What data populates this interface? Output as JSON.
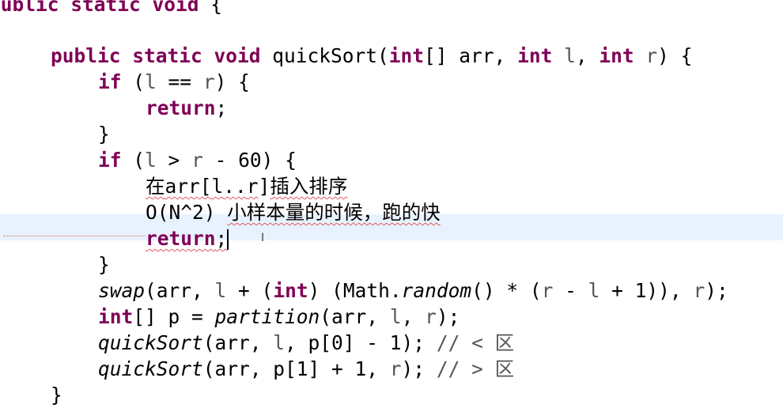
{
  "editor": {
    "current_line_index": 8,
    "colors": {
      "keyword": "#7f0055",
      "current_line": "#e8f2fe",
      "error_underline": "#e05a5a"
    },
    "lines": [
      {
        "indent": 0,
        "tokens": [
          {
            "t": "public static void ",
            "c": "kw"
          },
          {
            "t": "{",
            "c": ""
          }
        ]
      },
      {
        "indent": 0,
        "tokens": []
      },
      {
        "indent": 0,
        "tokens": [
          {
            "t": "public static void",
            "c": "kw"
          },
          {
            "t": " quickSort(",
            "c": ""
          },
          {
            "t": "int",
            "c": "kw"
          },
          {
            "t": "[] arr, ",
            "c": ""
          },
          {
            "t": "int",
            "c": "kw"
          },
          {
            "t": " ",
            "c": ""
          },
          {
            "t": "l",
            "c": "var"
          },
          {
            "t": ", ",
            "c": ""
          },
          {
            "t": "int",
            "c": "kw"
          },
          {
            "t": " ",
            "c": ""
          },
          {
            "t": "r",
            "c": "var"
          },
          {
            "t": ") {",
            "c": ""
          }
        ]
      },
      {
        "indent": 1,
        "tokens": [
          {
            "t": "if",
            "c": "kw"
          },
          {
            "t": " (",
            "c": ""
          },
          {
            "t": "l",
            "c": "var"
          },
          {
            "t": " == ",
            "c": ""
          },
          {
            "t": "r",
            "c": "var"
          },
          {
            "t": ") {",
            "c": ""
          }
        ]
      },
      {
        "indent": 2,
        "tokens": [
          {
            "t": "return",
            "c": "kw"
          },
          {
            "t": ";",
            "c": ""
          }
        ]
      },
      {
        "indent": 1,
        "tokens": [
          {
            "t": "}",
            "c": ""
          }
        ]
      },
      {
        "indent": 1,
        "tokens": [
          {
            "t": "if",
            "c": "kw"
          },
          {
            "t": " (",
            "c": ""
          },
          {
            "t": "l",
            "c": "var"
          },
          {
            "t": " > ",
            "c": ""
          },
          {
            "t": "r",
            "c": "var"
          },
          {
            "t": " - 60) {",
            "c": ""
          }
        ]
      },
      {
        "indent": 2,
        "tokens": [
          {
            "t": "在",
            "c": "cjk err"
          },
          {
            "t": "arr[",
            "c": "err"
          },
          {
            "t": "l",
            "c": "err"
          },
          {
            "t": "..",
            "c": "err"
          },
          {
            "t": "r",
            "c": "err"
          },
          {
            "t": "]",
            "c": ""
          },
          {
            "t": "插入排序",
            "c": "cjk err"
          }
        ]
      },
      {
        "indent": 2,
        "tokens": [
          {
            "t": "O(N^2) ",
            "c": ""
          },
          {
            "t": "小样本量的时候，跑的快",
            "c": "cjk err"
          }
        ]
      },
      {
        "indent": 2,
        "tokens": [
          {
            "t": "return",
            "c": "kw err"
          },
          {
            "t": ";",
            "c": "err"
          }
        ],
        "caret": true
      },
      {
        "indent": 1,
        "tokens": [
          {
            "t": "}",
            "c": ""
          }
        ]
      },
      {
        "indent": 1,
        "tokens": [
          {
            "t": "swap",
            "c": "it"
          },
          {
            "t": "(arr, ",
            "c": ""
          },
          {
            "t": "l",
            "c": "var"
          },
          {
            "t": " + (",
            "c": ""
          },
          {
            "t": "int",
            "c": "kw"
          },
          {
            "t": ") (Math.",
            "c": ""
          },
          {
            "t": "random",
            "c": "it"
          },
          {
            "t": "() * (",
            "c": ""
          },
          {
            "t": "r",
            "c": "var"
          },
          {
            "t": " - ",
            "c": ""
          },
          {
            "t": "l",
            "c": "var"
          },
          {
            "t": " + 1)), ",
            "c": ""
          },
          {
            "t": "r",
            "c": "var"
          },
          {
            "t": ");",
            "c": ""
          }
        ]
      },
      {
        "indent": 1,
        "tokens": [
          {
            "t": "int",
            "c": "kw"
          },
          {
            "t": "[] p = ",
            "c": ""
          },
          {
            "t": "partition",
            "c": "it"
          },
          {
            "t": "(arr, ",
            "c": ""
          },
          {
            "t": "l",
            "c": "var"
          },
          {
            "t": ", ",
            "c": ""
          },
          {
            "t": "r",
            "c": "var"
          },
          {
            "t": ");",
            "c": ""
          }
        ]
      },
      {
        "indent": 1,
        "tokens": [
          {
            "t": "quickSort",
            "c": "it"
          },
          {
            "t": "(arr, ",
            "c": ""
          },
          {
            "t": "l",
            "c": "var"
          },
          {
            "t": ", p[0] - 1); ",
            "c": ""
          },
          {
            "t": "// < ",
            "c": "cm"
          },
          {
            "t": "区",
            "c": "cm cjk"
          }
        ]
      },
      {
        "indent": 1,
        "tokens": [
          {
            "t": "quickSort",
            "c": "it"
          },
          {
            "t": "(arr, p[1] + 1, ",
            "c": ""
          },
          {
            "t": "r",
            "c": "var"
          },
          {
            "t": "); ",
            "c": ""
          },
          {
            "t": "// > ",
            "c": "cm"
          },
          {
            "t": "区",
            "c": "cm cjk"
          }
        ]
      },
      {
        "indent": 0,
        "tokens": [
          {
            "t": "}",
            "c": ""
          }
        ]
      }
    ]
  }
}
